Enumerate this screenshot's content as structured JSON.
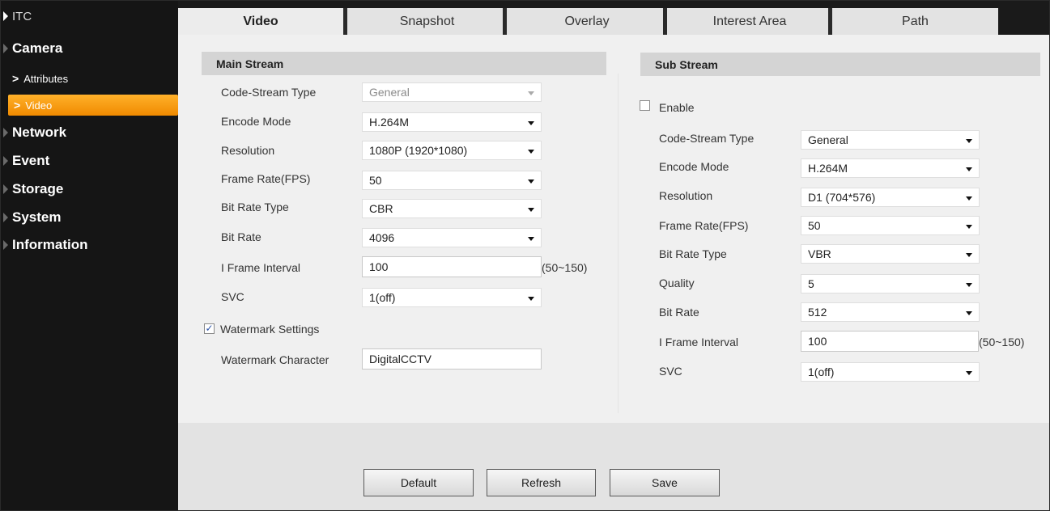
{
  "sidebar": {
    "root": "ITC",
    "camera": "Camera",
    "attributes": "Attributes",
    "video": "Video",
    "network": "Network",
    "event": "Event",
    "storage": "Storage",
    "system": "System",
    "information": "Information"
  },
  "tabs": {
    "video": "Video",
    "snapshot": "Snapshot",
    "overlay": "Overlay",
    "interest_area": "Interest Area",
    "path": "Path"
  },
  "main_stream": {
    "title": "Main Stream",
    "code_stream_type_label": "Code-Stream Type",
    "code_stream_type": "General",
    "encode_mode_label": "Encode Mode",
    "encode_mode": "H.264M",
    "resolution_label": "Resolution",
    "resolution": "1080P (1920*1080)",
    "frame_rate_label": "Frame Rate(FPS)",
    "frame_rate": "50",
    "bit_rate_type_label": "Bit Rate Type",
    "bit_rate_type": "CBR",
    "bit_rate_label": "Bit Rate",
    "bit_rate": "4096",
    "iframe_label": "I Frame Interval",
    "iframe": "100",
    "iframe_range": "(50~150)",
    "svc_label": "SVC",
    "svc": "1(off)",
    "watermark_settings_label": "Watermark Settings",
    "watermark_checked": "✓",
    "watermark_character_label": "Watermark Character",
    "watermark_character": "DigitalCCTV"
  },
  "sub_stream": {
    "title": "Sub Stream",
    "enable_label": "Enable",
    "code_stream_type_label": "Code-Stream Type",
    "code_stream_type": "General",
    "encode_mode_label": "Encode Mode",
    "encode_mode": "H.264M",
    "resolution_label": "Resolution",
    "resolution": "D1 (704*576)",
    "frame_rate_label": "Frame Rate(FPS)",
    "frame_rate": "50",
    "bit_rate_type_label": "Bit Rate Type",
    "bit_rate_type": "VBR",
    "quality_label": "Quality",
    "quality": "5",
    "bit_rate_label": "Bit Rate",
    "bit_rate": "512",
    "iframe_label": "I Frame Interval",
    "iframe": "100",
    "iframe_range": "(50~150)",
    "svc_label": "SVC",
    "svc": "1(off)"
  },
  "buttons": {
    "default": "Default",
    "refresh": "Refresh",
    "save": "Save"
  },
  "colors": {
    "active_menu": "#f49a10",
    "sidebar_bg": "#151515"
  }
}
